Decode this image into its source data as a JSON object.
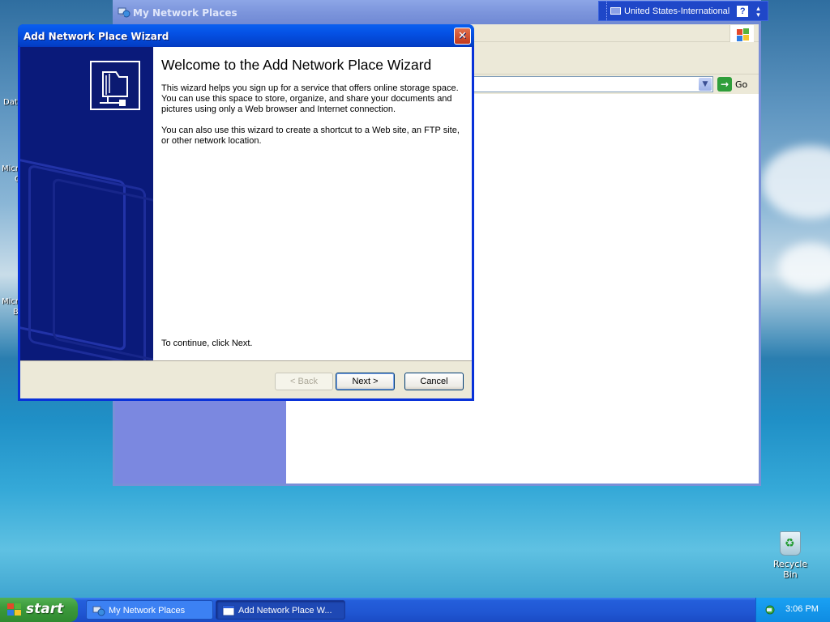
{
  "explorer": {
    "title": "My Network Places",
    "address_go": "Go"
  },
  "language_bar": {
    "language": "United States-International",
    "help": "?"
  },
  "desktop": {
    "partial_labels": [
      "Dat",
      "Micr",
      "C",
      "Micr",
      "B"
    ],
    "recycle_bin": "Recycle Bin"
  },
  "wizard": {
    "title": "Add Network Place Wizard",
    "heading": "Welcome to the Add Network Place Wizard",
    "paragraph1": "This wizard helps you sign up for a service that offers online storage space. You can use this space to store, organize, and share your documents and pictures using only a Web browser and Internet connection.",
    "paragraph2": "You can also use this wizard to create a shortcut to a Web site, an FTP site, or other network location.",
    "continue_text": "To continue, click Next.",
    "buttons": {
      "back": "< Back",
      "next": "Next >",
      "cancel": "Cancel"
    }
  },
  "taskbar": {
    "start_label": "start",
    "tasks": [
      {
        "label": "My Network Places",
        "active": false
      },
      {
        "label": "Add Network Place W...",
        "active": true
      }
    ],
    "clock": "3:06 PM"
  },
  "icons": [
    "network-places-icon",
    "keyboard-icon",
    "help-icon",
    "windows-logo-icon",
    "dropdown-arrow-icon",
    "go-arrow-icon",
    "close-icon",
    "network-folder-icon",
    "recycle-bin-icon",
    "windows-flag-icon",
    "wizard-window-icon",
    "network-tray-icon"
  ]
}
